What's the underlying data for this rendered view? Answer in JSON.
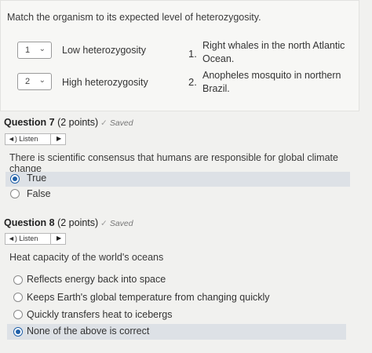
{
  "matching": {
    "prompt": "Match the organism to its expected level of heterozygosity.",
    "rows": [
      {
        "selected": "1",
        "label": "Low heterozygosity"
      },
      {
        "selected": "2",
        "label": "High heterozygosity"
      }
    ],
    "options": [
      {
        "num": "1.",
        "line1": "Right whales in the north Atlantic",
        "line2": "Ocean."
      },
      {
        "num": "2.",
        "line1": "Anopheles mosquito in northern",
        "line2": "Brazil."
      }
    ]
  },
  "q7": {
    "title": "Question 7",
    "points": "(2 points)",
    "saved": "Saved",
    "listen": "Listen",
    "text": "There is scientific consensus that humans are responsible for global climate change",
    "options": [
      "True",
      "False"
    ],
    "selected_index": 0
  },
  "q8": {
    "title": "Question 8",
    "points": "(2 points)",
    "saved": "Saved",
    "listen": "Listen",
    "text": "Heat capacity of the world's oceans",
    "options": [
      "Reflects energy back into space",
      "Keeps Earth's global temperature from changing quickly",
      "Quickly transfers heat to icebergs",
      "None of the above is correct"
    ],
    "selected_index": 3
  },
  "icons": {
    "chevron": "chevron-down-icon",
    "check": "checkmark-icon",
    "speaker": "speaker-icon",
    "play": "play-icon"
  },
  "colors": {
    "selected_radio": "#1f5fa8",
    "highlight_row": "#dde1e6"
  }
}
